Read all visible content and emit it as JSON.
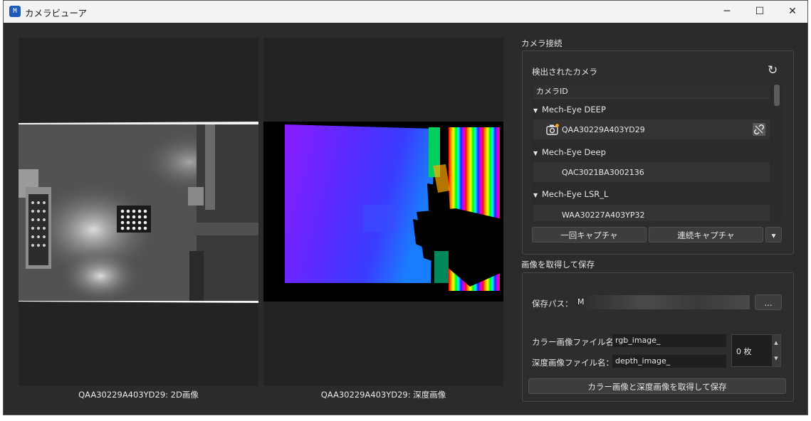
{
  "window": {
    "title": "カメラビューア",
    "app_icon_text": "M",
    "minimize": "─",
    "maximize": "☐",
    "close": "✕"
  },
  "images": {
    "left_caption": "QAA30229A403YD29: 2D画像",
    "right_caption": "QAA30229A403YD29: 深度画像"
  },
  "connection": {
    "group_title": "カメラ接続",
    "detected_label": "検出されたカメラ",
    "refresh_icon": "↻",
    "list_header": "カメラID",
    "groups": [
      {
        "name": "Mech-Eye DEEP",
        "serial": "QAA30229A403YD29",
        "connected": true
      },
      {
        "name": "Mech-Eye Deep",
        "serial": "QAC3021BA3002136",
        "connected": false
      },
      {
        "name": "Mech-Eye LSR_L",
        "serial": "WAA30227A403YP32",
        "connected": false
      }
    ],
    "single_capture": "一回キャプチャ",
    "continuous_capture": "連続キャプチャ",
    "dropdown_arrow": "▾"
  },
  "save": {
    "group_title": "画像を取得して保存",
    "path_label": "保存パス：",
    "path_value": "M",
    "browse": "...",
    "color_label": "カラー画像ファイル名：",
    "color_value": "rgb_image_",
    "depth_label": "深度画像ファイル名：",
    "depth_value": "depth_image_",
    "count": "0 枚",
    "save_button": "カラー画像と深度画像を取得して保存"
  }
}
